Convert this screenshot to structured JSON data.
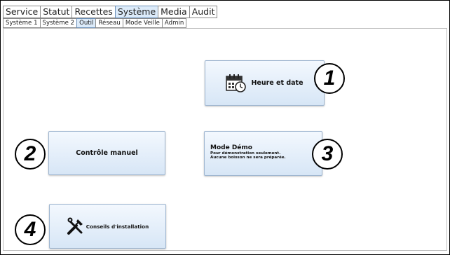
{
  "top_tabs": [
    "Service",
    "Statut",
    "Recettes",
    "Système",
    "Media",
    "Audit"
  ],
  "top_tabs_active": "Système",
  "sub_tabs": [
    "Système 1",
    "Système 2",
    "Outil",
    "Réseau",
    "Mode Veille",
    "Admin"
  ],
  "sub_tabs_active": "Outil",
  "buttons": {
    "datetime": {
      "label": "Heure et date",
      "icon": "calendar-clock-icon"
    },
    "manual_control": {
      "label": "Contrôle manuel"
    },
    "demo_mode": {
      "title": "Mode Démo",
      "line1": "Pour démonstration seulement.",
      "line2": "Aucune boisson ne sera préparée."
    },
    "install_tips": {
      "label": "Conseils d'installation",
      "icon": "tools-icon"
    }
  },
  "callouts": [
    "1",
    "2",
    "3",
    "4"
  ],
  "colors": {
    "active_tab": "#dcebfa",
    "button_top": "#f3f8fe",
    "button_bottom": "#d7e6f6"
  }
}
